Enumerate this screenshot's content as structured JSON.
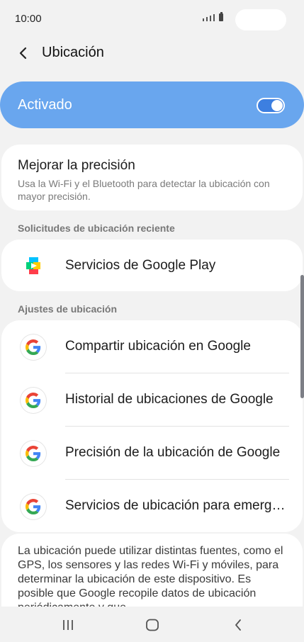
{
  "status": {
    "time": "10:00"
  },
  "header": {
    "title": "Ubicación"
  },
  "toggle": {
    "label": "Activado",
    "on": true
  },
  "improve": {
    "title": "Mejorar la precisión",
    "subtitle": "Usa la Wi-Fi y el Bluetooth para detectar la ubicación con mayor precisión."
  },
  "recent": {
    "header": "Solicitudes de ubicación reciente",
    "items": [
      {
        "label": "Servicios de Google Play",
        "icon": "google-play-icon"
      }
    ]
  },
  "settings": {
    "header": "Ajustes de ubicación",
    "items": [
      {
        "label": "Compartir ubicación en Google",
        "icon": "google-g-icon"
      },
      {
        "label": "Historial de ubicaciones de Google",
        "icon": "google-g-icon"
      },
      {
        "label": "Precisión de la ubicación de Google",
        "icon": "google-g-icon"
      },
      {
        "label": "Servicios de ubicación para emergencias",
        "icon": "google-g-icon"
      }
    ]
  },
  "info": {
    "text": "La ubicación puede utilizar distintas fuentes, como el GPS, los sensores y las redes Wi-Fi y móviles, para determinar la ubicación de este dispositivo. Es posible que Google recopile datos de ubicación periódicamente y que"
  },
  "colors": {
    "accent": "#69a6ee",
    "switch": "#3d7fe0",
    "background": "#f2f2f2"
  }
}
